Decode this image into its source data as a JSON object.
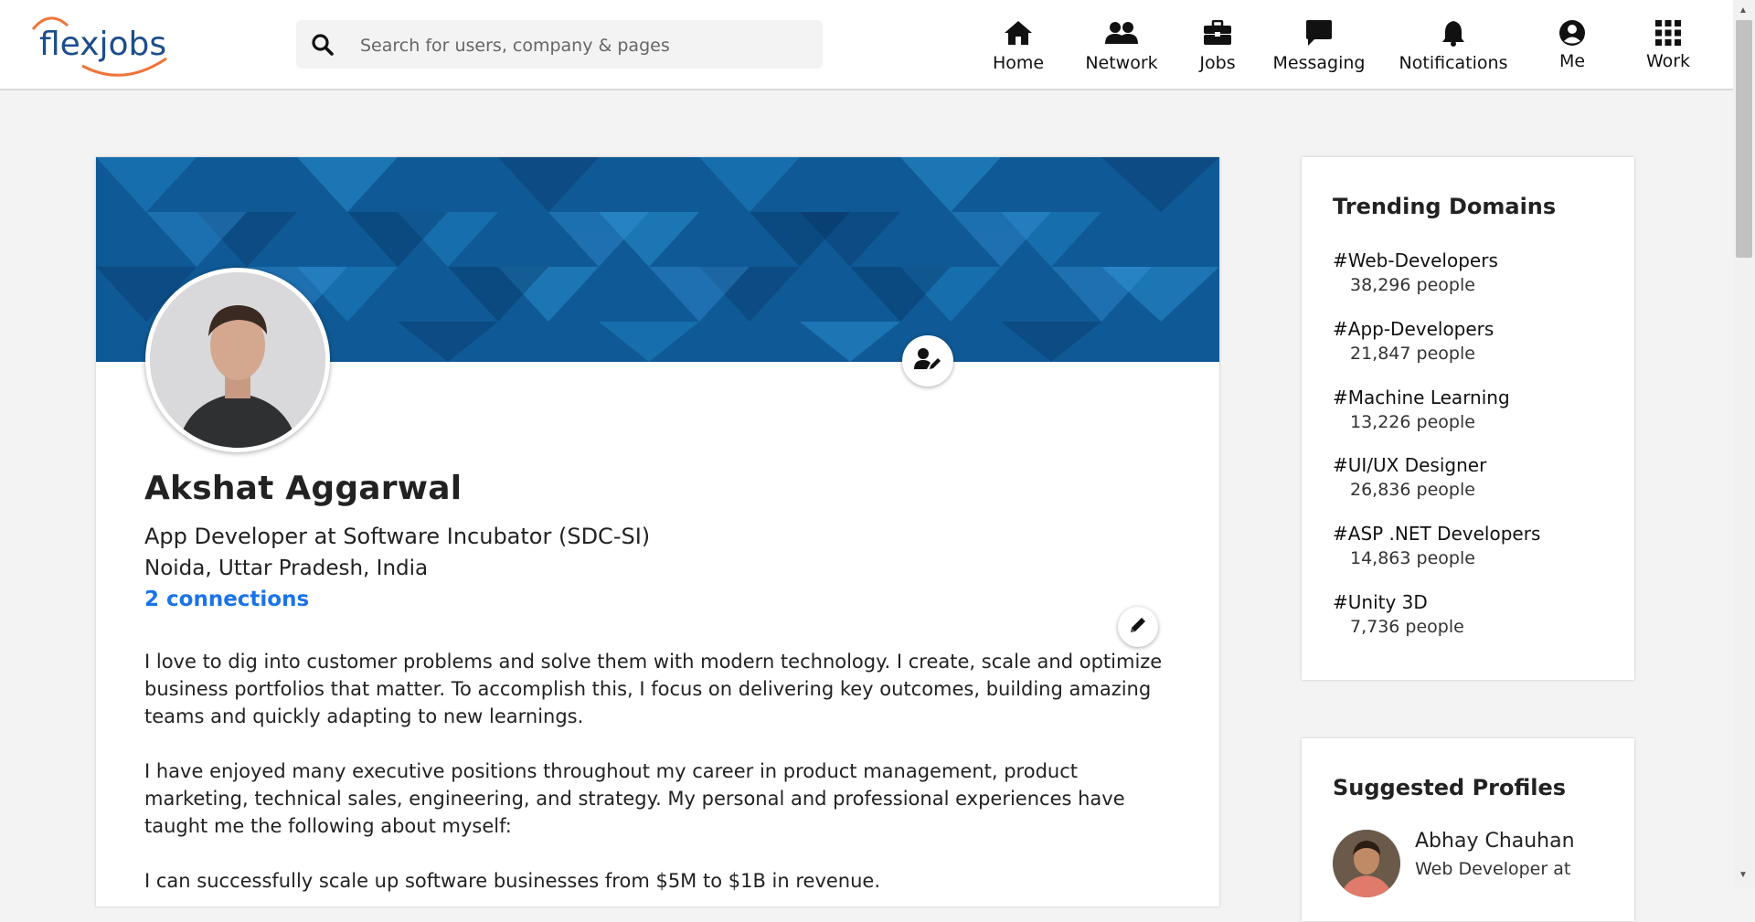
{
  "brand": {
    "logo_text": "flexjobs",
    "logo_arc_color": "#f0743a",
    "logo_text_color": "#1c4e8c"
  },
  "search": {
    "placeholder": "Search for users, company & pages",
    "icon": "search-icon"
  },
  "nav": [
    {
      "label": "Home",
      "icon": "home-icon"
    },
    {
      "label": "Network",
      "icon": "people-icon"
    },
    {
      "label": "Jobs",
      "icon": "briefcase-icon"
    },
    {
      "label": "Messaging",
      "icon": "chat-bubble-icon"
    },
    {
      "label": "Notifications",
      "icon": "bell-icon"
    },
    {
      "label": "Me",
      "icon": "user-circle-icon"
    },
    {
      "label": "Work",
      "icon": "grid-icon"
    }
  ],
  "profile": {
    "name": "Akshat Aggarwal",
    "headline": "App Developer at Software Incubator (SDC-SI)",
    "location": "Noida, Uttar Pradesh, India",
    "connections": "2 connections",
    "about": [
      "I love to dig into customer problems and solve them with modern technology. I create, scale and optimize business portfolios that matter. To accomplish this, I focus on delivering key outcomes, building amazing teams and quickly adapting to new learnings.",
      "I have enjoyed many executive positions throughout my career in product management, product marketing, technical sales, engineering, and strategy. My personal and professional experiences have taught me the following about myself:",
      "I can successfully scale up software businesses from $5M to $1B in revenue."
    ],
    "banner_colors": [
      "#0f5a96",
      "#1f7fc0",
      "#0b3f74"
    ]
  },
  "trending": {
    "title": "Trending Domains",
    "items": [
      {
        "name": "#Web-Developers",
        "count": "38,296 people"
      },
      {
        "name": "#App-Developers",
        "count": "21,847 people"
      },
      {
        "name": "#Machine Learning",
        "count": "13,226 people"
      },
      {
        "name": "#UI/UX Designer",
        "count": "26,836 people"
      },
      {
        "name": "#ASP .NET Developers",
        "count": "14,863 people"
      },
      {
        "name": "#Unity 3D",
        "count": "7,736 people"
      }
    ]
  },
  "suggested": {
    "title": "Suggested Profiles",
    "items": [
      {
        "name": "Abhay Chauhan",
        "role": "Web Developer at"
      }
    ]
  },
  "colors": {
    "link": "#1a73e8",
    "page_bg": "#f3f3f3"
  }
}
